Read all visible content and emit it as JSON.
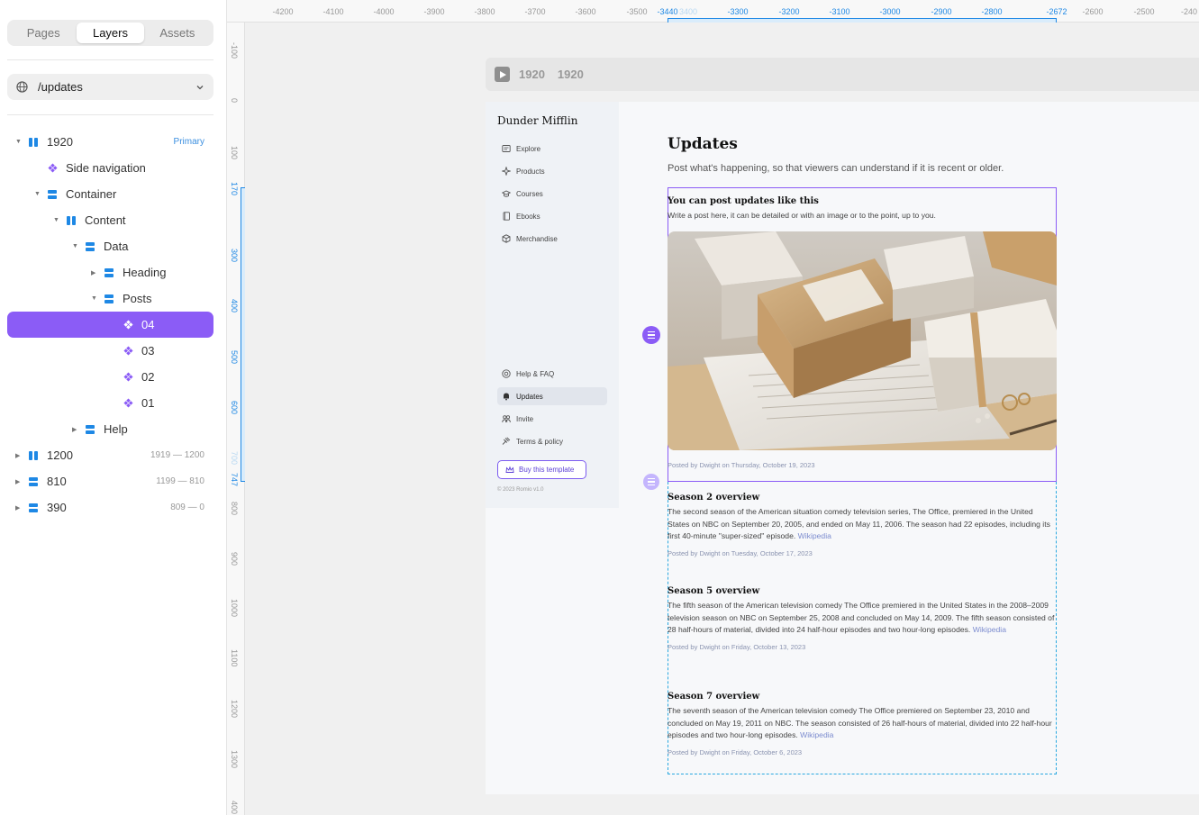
{
  "panel": {
    "tabs": [
      "Pages",
      "Layers",
      "Assets"
    ],
    "active_tab": "Layers",
    "route": "/updates"
  },
  "layers": [
    {
      "label": "1920",
      "meta": "Primary"
    },
    {
      "label": "Side navigation"
    },
    {
      "label": "Container"
    },
    {
      "label": "Content"
    },
    {
      "label": "Data"
    },
    {
      "label": "Heading"
    },
    {
      "label": "Posts"
    },
    {
      "label": "04",
      "selected": true
    },
    {
      "label": "03"
    },
    {
      "label": "02"
    },
    {
      "label": "01"
    },
    {
      "label": "Help"
    },
    {
      "label": "1200",
      "meta": "1919 — 1200"
    },
    {
      "label": "810",
      "meta": "1199 — 810"
    },
    {
      "label": "390",
      "meta": "809 — 0"
    }
  ],
  "ruler": {
    "top": [
      "-4200",
      "-4100",
      "-4000",
      "-3900",
      "-3800",
      "-3700",
      "-3600",
      "-3500",
      "-3440",
      "3400",
      "-3300",
      "-3200",
      "-3100",
      "-3000",
      "-2900",
      "-2800",
      "-2672",
      "-2600",
      "-2500",
      "-240"
    ],
    "left": [
      "-100",
      "0",
      "100",
      "170",
      "300",
      "400",
      "500",
      "600",
      "700",
      "747",
      "800",
      "900",
      "1000",
      "1100",
      "1200",
      "1300",
      "400"
    ]
  },
  "frame": {
    "label_a": "1920",
    "label_b": "1920"
  },
  "site": {
    "brand": "Dunder Mifflin",
    "nav_top": [
      "Explore",
      "Products",
      "Courses",
      "Ebooks",
      "Merchandise"
    ],
    "nav_bottom": [
      "Help & FAQ",
      "Updates",
      "Invite",
      "Terms & policy"
    ],
    "active_nav": "Updates",
    "buy_label": "Buy this template",
    "copyright": "© 2023 Romio v1.0",
    "title": "Updates",
    "subtitle": "Post what's happening, so that viewers can understand if it is recent or older."
  },
  "posts": [
    {
      "title": "You can post updates like this",
      "body": "Write a post here, it can be detailed or with an image or to the point, up to you.",
      "link": "",
      "byline": "Posted by Dwight on Thursday, October 19, 2023"
    },
    {
      "title": "Season 2 overview",
      "body": "The second season of the American situation comedy television series, The Office, premiered in the United States on NBC on September 20, 2005, and ended on May 11, 2006. The season had 22 episodes, including its first 40-minute \"super-sized\" episode.",
      "link": "Wikipedia",
      "byline": "Posted by Dwight on Tuesday, October 17, 2023"
    },
    {
      "title": "Season 5 overview",
      "body": "The fifth season of the American television comedy The Office premiered in the United States in the 2008–2009 television season on NBC on September 25, 2008 and concluded on May 14, 2009. The fifth season consisted of 28 half-hours of material, divided into 24 half-hour episodes and two hour-long episodes.",
      "link": "Wikipedia",
      "byline": "Posted by Dwight on Friday, October 13, 2023"
    },
    {
      "title": "Season 7 overview",
      "body": "The seventh season of the American television comedy The Office premiered on September 23, 2010 and concluded on May 19, 2011 on NBC. The season consisted of 26 half-hours of material, divided into 22 half-hour episodes and two hour-long episodes.",
      "link": "Wikipedia",
      "byline": "Posted by Dwight on Friday, October 6, 2023"
    }
  ],
  "colors": {
    "accent": "#8b5cf6",
    "ruler_highlight": "#1e88e5",
    "guide": "#29a8e0"
  }
}
